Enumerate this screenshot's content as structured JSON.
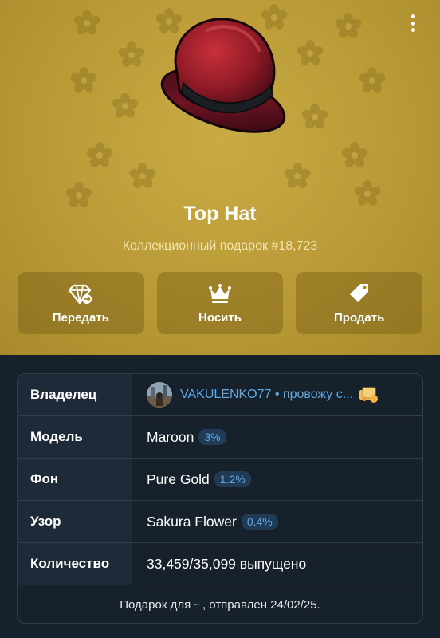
{
  "gift": {
    "title": "Top Hat",
    "subtitle": "Коллекционный подарок #18,723"
  },
  "colors": {
    "hero_background": "#b99a36",
    "panel_background": "#17212b",
    "link": "#5ea8e8"
  },
  "actions": [
    {
      "label": "Передать",
      "icon": "gift-transfer-icon"
    },
    {
      "label": "Носить",
      "icon": "crown-icon"
    },
    {
      "label": "Продать",
      "icon": "price-tag-icon"
    }
  ],
  "details": {
    "owner": {
      "key": "Владелец",
      "name": "VAKULENKO77 • провожу с..."
    },
    "model": {
      "key": "Модель",
      "value": "Maroon",
      "rarity": "3%"
    },
    "backdrop": {
      "key": "Фон",
      "value": "Pure Gold",
      "rarity": "1.2%"
    },
    "pattern": {
      "key": "Узор",
      "value": "Sakura Flower",
      "rarity": "0.4%"
    },
    "quantity": {
      "key": "Количество",
      "value": "33,459/35,099 выпущено"
    }
  },
  "footer": {
    "prefix": "Подарок для",
    "recipient": "~",
    "suffix": ", отправлен 24/02/25."
  }
}
